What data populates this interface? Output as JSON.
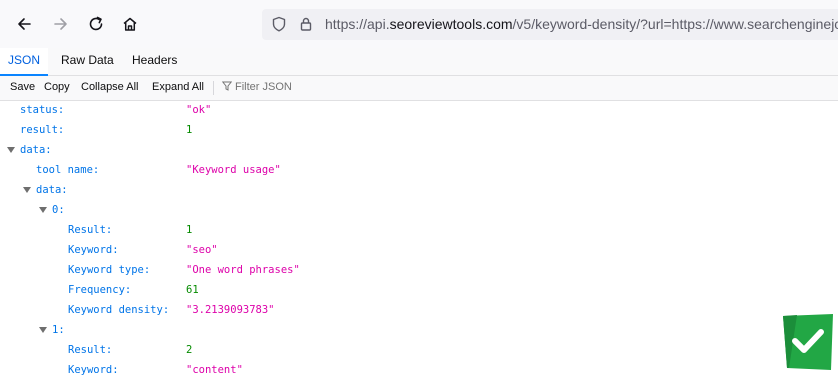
{
  "browser": {
    "url_prefix": "https://api.",
    "url_host": "seoreviewtools.com",
    "url_suffix": "/v5/keyword-density/?url=https://www.searchenginejc"
  },
  "tabs": [
    "JSON",
    "Raw Data",
    "Headers"
  ],
  "toolbar": {
    "save": "Save",
    "copy": "Copy",
    "collapse_all": "Collapse All",
    "expand_all": "Expand All",
    "filter_placeholder": "Filter JSON"
  },
  "json": {
    "status_key": "status:",
    "status_val": "\"ok\"",
    "result_key": "result:",
    "result_val": "1",
    "data_key": "data:",
    "tool_name_key": "tool name:",
    "tool_name_val": "\"Keyword usage\"",
    "inner_data_key": "data:",
    "items": [
      {
        "index": "0:",
        "result_key": "Result:",
        "result_val": "1",
        "keyword_key": "Keyword:",
        "keyword_val": "\"seo\"",
        "type_key": "Keyword type:",
        "type_val": "\"One word phrases\"",
        "frequency_key": "Frequency:",
        "frequency_val": "61",
        "density_key": "Keyword density:",
        "density_val": "\"3.2139093783\""
      },
      {
        "index": "1:",
        "result_key": "Result:",
        "result_val": "2",
        "keyword_key": "Keyword:",
        "keyword_val": "\"content\""
      }
    ]
  },
  "colors": {
    "key": "#0074e8",
    "string": "#dd00a9",
    "number": "#058b00",
    "tab_active": "#0060df",
    "badge": "#22a745"
  }
}
